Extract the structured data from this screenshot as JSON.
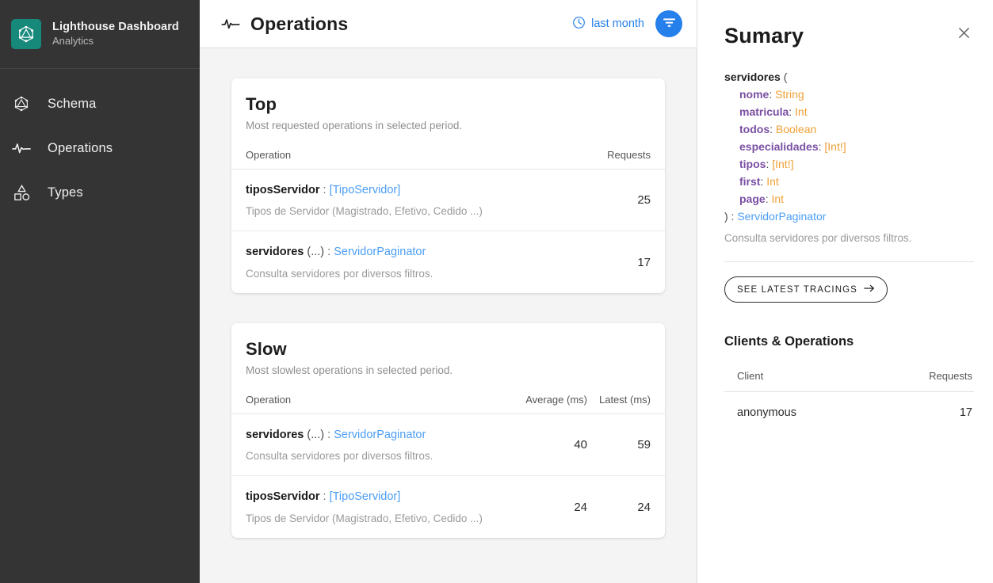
{
  "sidebar": {
    "brand": {
      "logo_icon": "graphql-logo-icon",
      "title": "Lighthouse Dashboard",
      "subtitle": "Analytics"
    },
    "items": [
      {
        "icon": "graphql-hexagon-icon",
        "label": "Schema"
      },
      {
        "icon": "activity-pulse-icon",
        "label": "Operations"
      },
      {
        "icon": "shapes-types-icon",
        "label": "Types"
      }
    ]
  },
  "header": {
    "icon": "activity-pulse-icon",
    "title": "Operations",
    "period_icon": "clock-icon",
    "period_label": "last month",
    "filter_icon": "filter-funnel-icon"
  },
  "cards": [
    {
      "title": "Top",
      "subtitle": "Most requested operations in selected period.",
      "columns": [
        "Operation",
        "Requests"
      ],
      "rows": [
        {
          "name": "tiposServidor",
          "args": "",
          "separator": " : ",
          "return_type": "[TipoServidor]",
          "description": "Tipos de Servidor (Magistrado, Efetivo, Cedido ...)",
          "values": [
            "25"
          ]
        },
        {
          "name": "servidores",
          "args": " (...)",
          "separator": " : ",
          "return_type": "ServidorPaginator",
          "description": "Consulta servidores por diversos filtros.",
          "values": [
            "17"
          ]
        }
      ]
    },
    {
      "title": "Slow",
      "subtitle": "Most slowlest operations in selected period.",
      "columns": [
        "Operation",
        "Average (ms)",
        "Latest (ms)"
      ],
      "rows": [
        {
          "name": "servidores",
          "args": " (...)",
          "separator": " : ",
          "return_type": "ServidorPaginator",
          "description": "Consulta servidores por diversos filtros.",
          "values": [
            "40",
            "59"
          ]
        },
        {
          "name": "tiposServidor",
          "args": "",
          "separator": " : ",
          "return_type": "[TipoServidor]",
          "description": "Tipos de Servidor (Magistrado, Efetivo, Cedido ...)",
          "values": [
            "24",
            "24"
          ]
        }
      ]
    }
  ],
  "summary": {
    "title": "Sumary",
    "close_icon": "close-icon",
    "signature": {
      "field_name": "servidores",
      "open_paren": " (",
      "args": [
        {
          "name": "nome",
          "sep": ": ",
          "type": "String"
        },
        {
          "name": "matricula",
          "sep": ": ",
          "type": "Int"
        },
        {
          "name": "todos",
          "sep": ": ",
          "type": "Boolean"
        },
        {
          "name": "especialidades",
          "sep": ": ",
          "type": "[Int!]"
        },
        {
          "name": "tipos",
          "sep": ": ",
          "type": "[Int!]"
        },
        {
          "name": "first",
          "sep": ": ",
          "type": "Int"
        },
        {
          "name": "page",
          "sep": ": ",
          "type": "Int"
        }
      ],
      "close_paren": ") : ",
      "return_type": "ServidorPaginator"
    },
    "description": "Consulta servidores por diversos filtros.",
    "tracings_button": {
      "label": "SEE LATEST TRACINGS",
      "icon": "arrow-right-icon"
    },
    "clients_section_title": "Clients & Operations",
    "clients_table": {
      "columns": [
        "Client",
        "Requests"
      ],
      "rows": [
        {
          "client": "anonymous",
          "requests": "17"
        }
      ]
    }
  },
  "colors": {
    "sidebar_bg": "#343434",
    "brand_teal": "#17897b",
    "accent_blue": "#2680eb",
    "link_blue": "#4b9ef5",
    "arg_purple": "#7a4fa3",
    "type_orange": "#f0a035",
    "page_bg": "#f4f4f4"
  }
}
